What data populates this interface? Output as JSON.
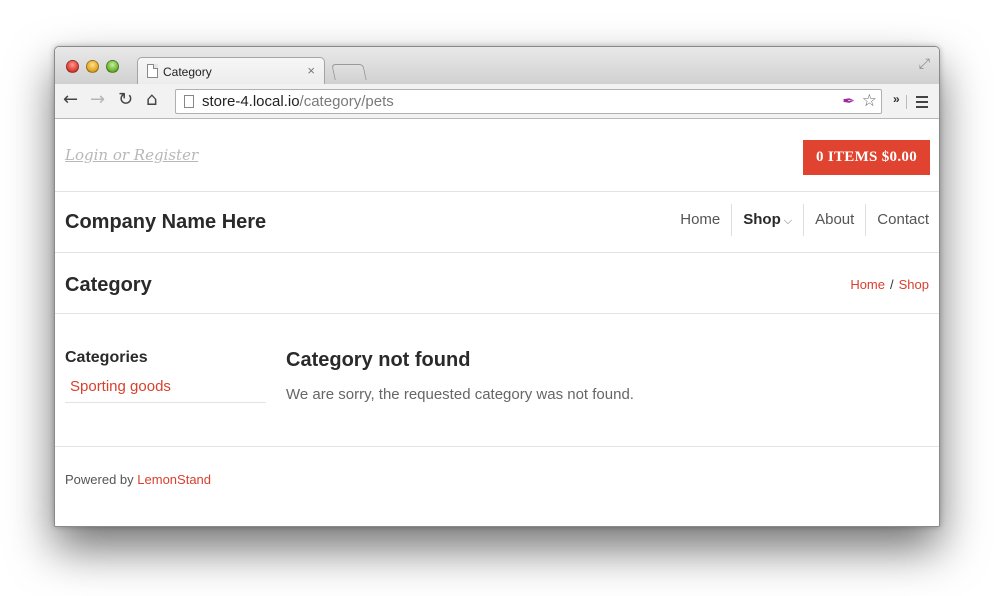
{
  "browser": {
    "tab_title": "Category",
    "tab_close": "×",
    "url_host": "store-4.local.io",
    "url_path": "/category/pets",
    "chevron": "»",
    "icons": [
      "back-arrow-icon",
      "forward-arrow-icon",
      "reload-icon",
      "home-icon",
      "page-icon",
      "extension-icon",
      "star-icon",
      "menu-icon"
    ]
  },
  "header": {
    "login_link": "Login or Register",
    "cart_button": "0 ITEMS $0.00",
    "company_name": "Company Name Here"
  },
  "nav": {
    "items": [
      {
        "label": "Home"
      },
      {
        "label": "Shop",
        "active": true
      },
      {
        "label": "About"
      },
      {
        "label": "Contact"
      }
    ]
  },
  "page": {
    "title": "Category",
    "breadcrumb": [
      "Home",
      "Shop"
    ],
    "breadcrumb_sep": "/"
  },
  "sidebar": {
    "title": "Categories",
    "items": [
      {
        "label": "Sporting goods"
      }
    ]
  },
  "main": {
    "heading": "Category not found",
    "message": "We are sorry, the requested category was not found."
  },
  "footer": {
    "prefix": "Powered by",
    "link": "LemonStand"
  },
  "colors": {
    "accent": "#e04430",
    "link": "#d8402e"
  }
}
